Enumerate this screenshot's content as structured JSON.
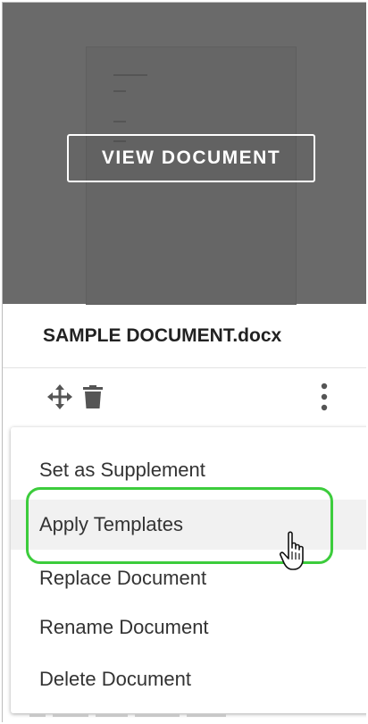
{
  "preview": {
    "view_button_label": "VIEW DOCUMENT"
  },
  "document": {
    "file_name": "SAMPLE DOCUMENT.docx"
  },
  "toolbar": {
    "icons": [
      "move-icon",
      "trash-icon",
      "more-vertical-icon"
    ]
  },
  "menu": {
    "items": [
      {
        "label": "Set as Supplement"
      },
      {
        "label": "Apply Templates"
      },
      {
        "label": "Replace Document"
      },
      {
        "label": "Rename Document"
      },
      {
        "label": "Delete Document"
      }
    ],
    "hovered_index": 1
  },
  "colors": {
    "preview_bg": "#6a6a6a",
    "highlight": "#3ccc3c",
    "text": "#333333"
  }
}
